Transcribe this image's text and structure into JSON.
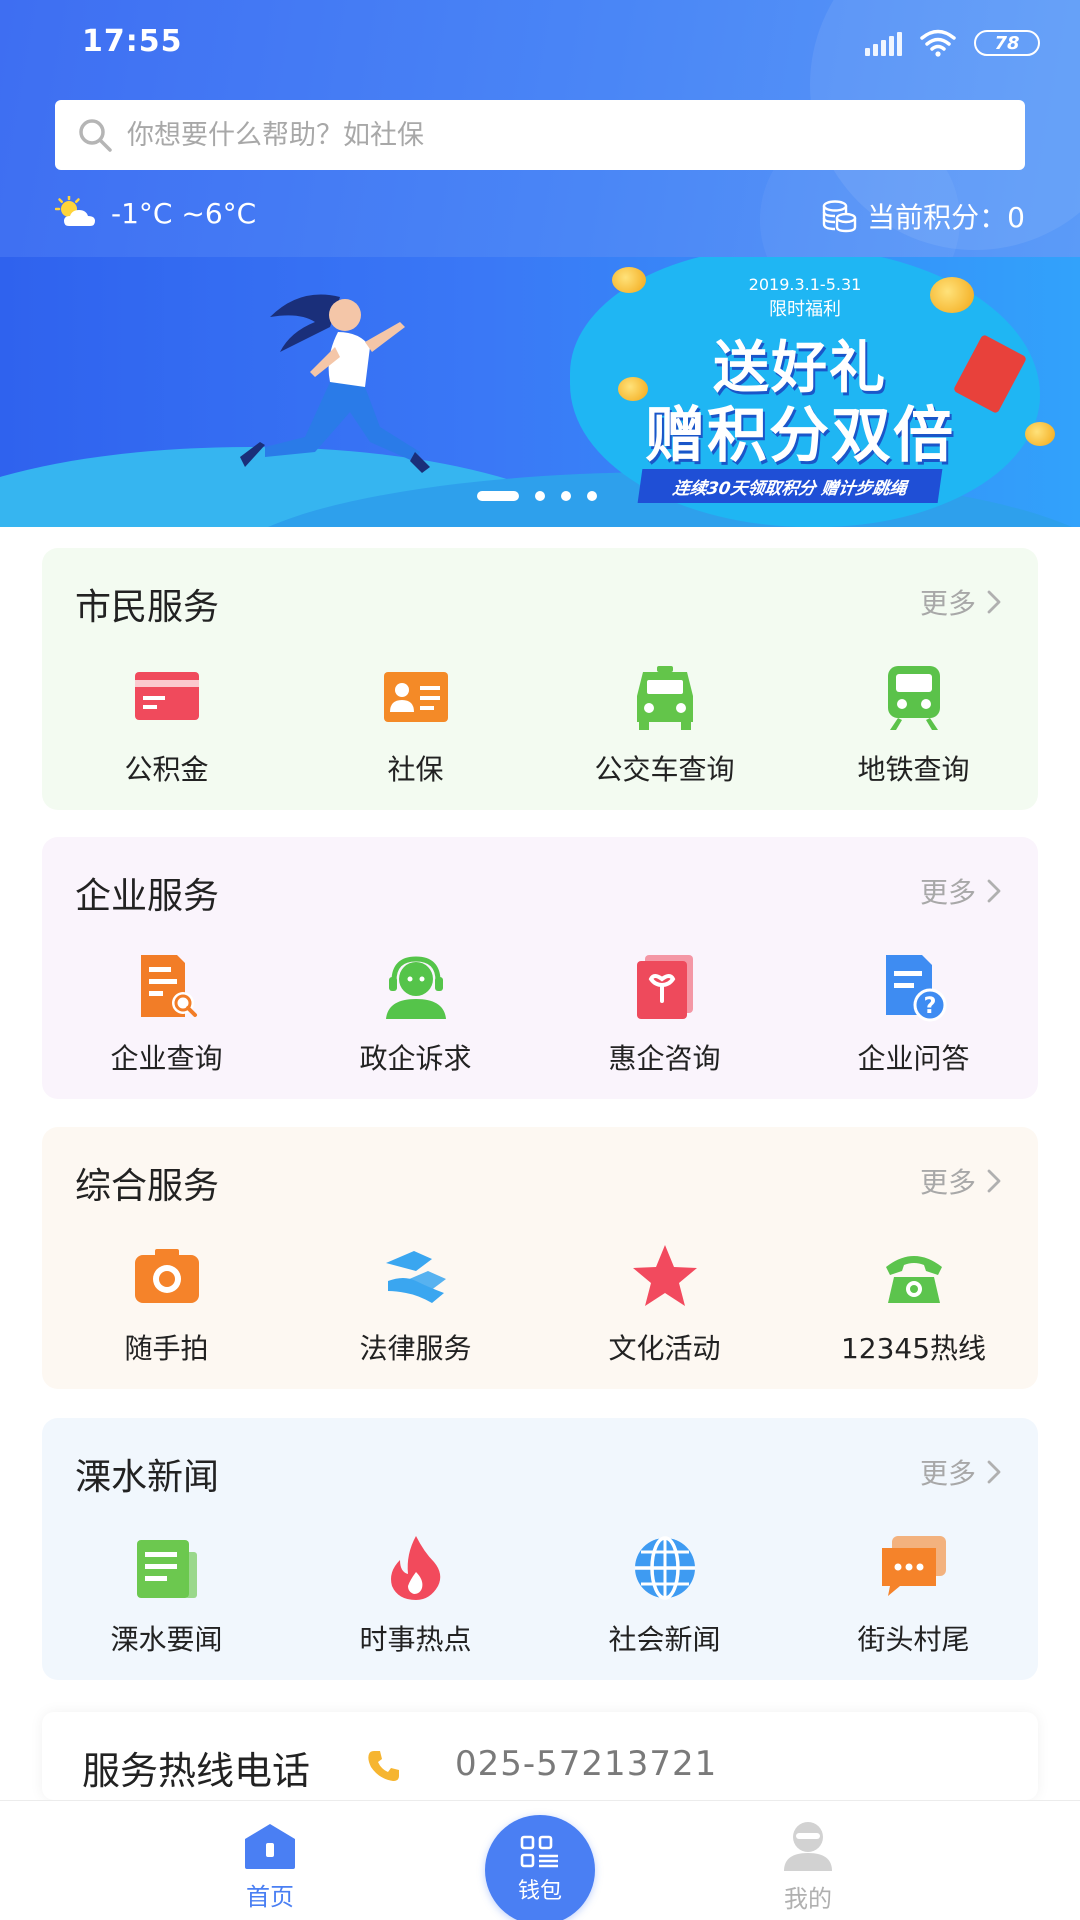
{
  "status_bar": {
    "time": "17:55",
    "battery": "78"
  },
  "search": {
    "placeholder": "你想要什么帮助？如社保"
  },
  "weather": {
    "temperature": "-1°C ~6°C"
  },
  "points": {
    "label": "当前积分：0"
  },
  "banner": {
    "date_range": "2019.3.1-5.31",
    "benefit": "限时福利",
    "headline_line1": "送好礼",
    "headline_line2": "赠积分双倍",
    "ribbon": "连续30天领取积分 赠计步跳绳",
    "carousel_active_index": 0,
    "carousel_count": 4
  },
  "sections": [
    {
      "title": "市民服务",
      "more": "更多",
      "bg": "#f3fbf1",
      "items": [
        {
          "label": "公积金",
          "icon": "card-icon",
          "color": "#f04a5c"
        },
        {
          "label": "社保",
          "icon": "id-card-icon",
          "color": "#f48a27"
        },
        {
          "label": "公交车查询",
          "icon": "bus-icon",
          "color": "#63c54a"
        },
        {
          "label": "地铁查询",
          "icon": "metro-icon",
          "color": "#5bc24a"
        }
      ]
    },
    {
      "title": "企业服务",
      "more": "更多",
      "bg": "#faf4fc",
      "items": [
        {
          "label": "企业查询",
          "icon": "document-search-icon",
          "color": "#f27d27"
        },
        {
          "label": "政企诉求",
          "icon": "customer-service-icon",
          "color": "#55c44a"
        },
        {
          "label": "惠企咨询",
          "icon": "book-icon",
          "color": "#ee4a5c"
        },
        {
          "label": "企业问答",
          "icon": "faq-document-icon",
          "color": "#3e8cf2"
        }
      ]
    },
    {
      "title": "综合服务",
      "more": "更多",
      "bg": "#fdf8f2",
      "items": [
        {
          "label": "随手拍",
          "icon": "camera-icon",
          "color": "#f5832a"
        },
        {
          "label": "法律服务",
          "icon": "handshake-icon",
          "color": "#3aa6f0"
        },
        {
          "label": "文化活动",
          "icon": "star-icon",
          "color": "#f24a5e"
        },
        {
          "label": "12345热线",
          "icon": "telephone-icon",
          "color": "#5cc44d"
        }
      ]
    },
    {
      "title": "溧水新闻",
      "more": "更多",
      "bg": "#f1f7fd",
      "items": [
        {
          "label": "溧水要闻",
          "icon": "newspaper-icon",
          "color": "#6cc84f"
        },
        {
          "label": "时事热点",
          "icon": "flame-icon",
          "color": "#f24a5c"
        },
        {
          "label": "社会新闻",
          "icon": "globe-icon",
          "color": "#3e9bf2"
        },
        {
          "label": "街头村尾",
          "icon": "chat-bubble-icon",
          "color": "#f5832a"
        }
      ]
    }
  ],
  "hotline": {
    "title": "服务热线电话",
    "number": "025-57213721"
  },
  "tabbar": [
    {
      "label": "首页",
      "icon": "home-icon",
      "active": true
    },
    {
      "label": "钱包",
      "icon": "wallet-qr-icon",
      "active": false
    },
    {
      "label": "我的",
      "icon": "profile-icon",
      "active": false
    }
  ],
  "colors": {
    "primary": "#3e6ef2",
    "tab_active": "#4a7ff3",
    "tab_inactive": "#b0b0b0"
  }
}
